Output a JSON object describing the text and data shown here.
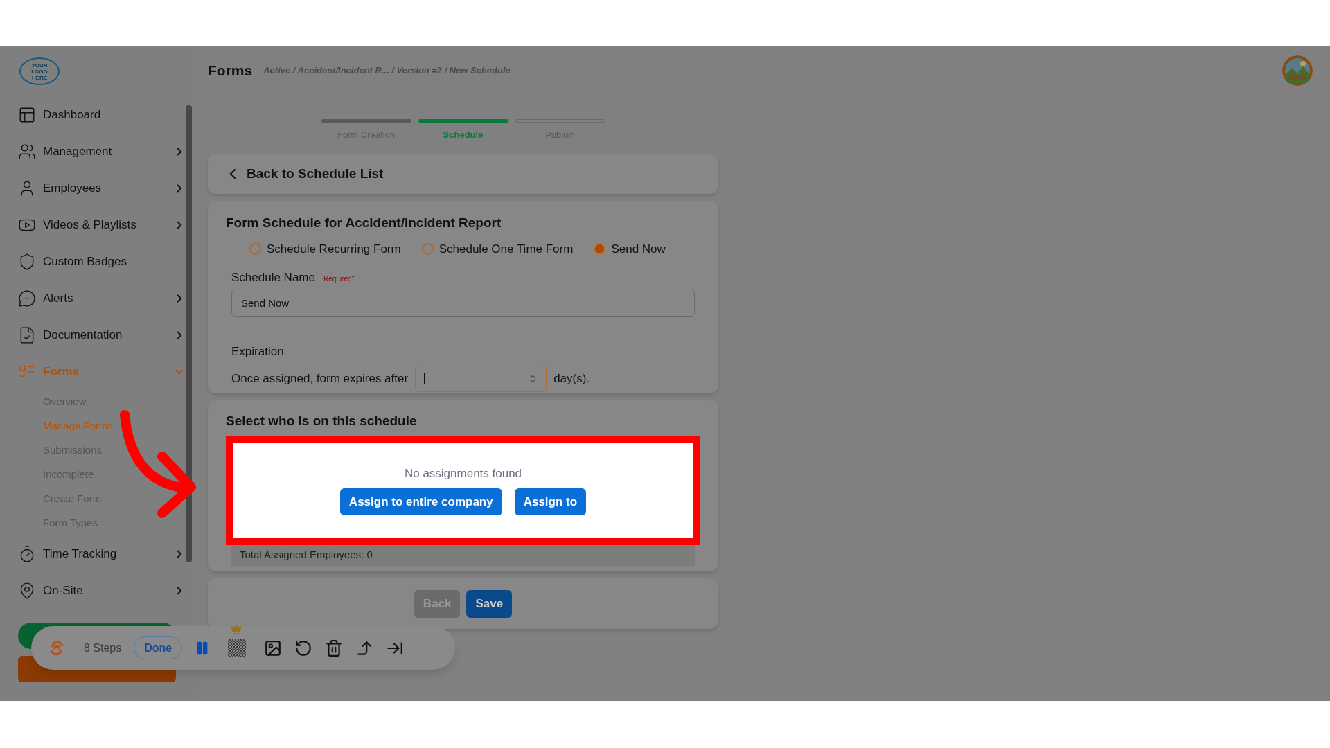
{
  "header": {
    "title": "Forms",
    "breadcrumbs": "Active / Accident/Incident R... / Version #2 / New Schedule"
  },
  "sidebar": {
    "logo_lines": [
      "YOUR",
      "LOGO",
      "HERE"
    ],
    "items": [
      {
        "kind": "dashboard",
        "label": "Dashboard",
        "selected": false
      },
      {
        "kind": "management",
        "label": "Management",
        "selected": false,
        "expanded": false
      },
      {
        "kind": "employees",
        "label": "Employees",
        "selected": false,
        "expanded": false
      },
      {
        "kind": "videos",
        "label": "Videos & Playlists",
        "selected": false,
        "expanded": false
      },
      {
        "kind": "badges",
        "label": "Custom Badges",
        "selected": false
      },
      {
        "kind": "alerts",
        "label": "Alerts",
        "selected": false,
        "expanded": false
      },
      {
        "kind": "documentation",
        "label": "Documentation",
        "selected": false,
        "expanded": false
      },
      {
        "kind": "forms",
        "label": "Forms",
        "selected": true,
        "expanded": true,
        "children": [
          {
            "label": "Overview",
            "selected": false
          },
          {
            "label": "Manage Forms",
            "selected": true
          },
          {
            "label": "Submissions",
            "selected": false
          },
          {
            "label": "Incomplete",
            "selected": false
          },
          {
            "label": "Create Form",
            "selected": false
          },
          {
            "label": "Form Types",
            "selected": false
          }
        ]
      },
      {
        "kind": "time",
        "label": "Time Tracking",
        "selected": false,
        "expanded": false
      },
      {
        "kind": "onsite",
        "label": "On-Site",
        "selected": false,
        "expanded": false
      }
    ]
  },
  "stepper": [
    {
      "label": "Form Creation",
      "completed": true,
      "selected": false
    },
    {
      "label": "Schedule",
      "completed": false,
      "selected": true
    },
    {
      "label": "Publish",
      "completed": false,
      "selected": false
    }
  ],
  "back_link": "Back to Schedule List",
  "schedule": {
    "title": "Form Schedule for Accident/Incident Report",
    "options": [
      {
        "label": "Schedule Recurring Form",
        "selected": false
      },
      {
        "label": "Schedule One Time Form",
        "selected": false
      },
      {
        "label": "Send Now",
        "selected": true
      }
    ],
    "name_label": "Schedule Name",
    "required": "Required*",
    "name_value": "Send Now",
    "expiration_label": "Expiration",
    "expires_text": "Once assigned, form expires after",
    "days_suffix": "day(s)."
  },
  "assignment": {
    "title": "Select who is on this schedule",
    "empty": "No assignments found",
    "buttons": [
      "Assign to entire company",
      "Assign to"
    ],
    "total": "Total Assigned Employees: 0"
  },
  "footer_buttons": [
    {
      "label": "Back",
      "disabled": true
    },
    {
      "label": "Save",
      "disabled": false
    }
  ],
  "recorder": {
    "steps": "8 Steps",
    "done": "Done"
  }
}
